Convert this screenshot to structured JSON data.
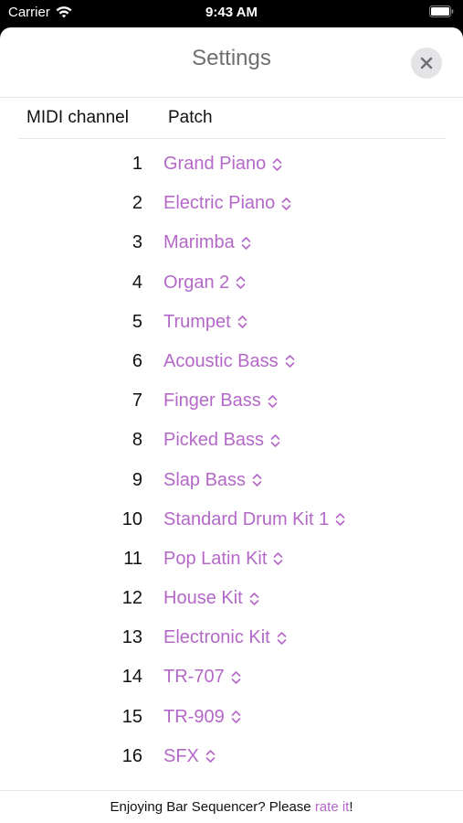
{
  "status_bar": {
    "carrier": "Carrier",
    "time": "9:43 AM"
  },
  "sheet": {
    "title": "Settings",
    "close_icon": "close-icon"
  },
  "table": {
    "headers": {
      "channel": "MIDI channel",
      "patch": "Patch"
    },
    "rows": [
      {
        "channel": "1",
        "patch": "Grand Piano"
      },
      {
        "channel": "2",
        "patch": "Electric Piano"
      },
      {
        "channel": "3",
        "patch": "Marimba"
      },
      {
        "channel": "4",
        "patch": "Organ 2"
      },
      {
        "channel": "5",
        "patch": "Trumpet"
      },
      {
        "channel": "6",
        "patch": "Acoustic Bass"
      },
      {
        "channel": "7",
        "patch": "Finger Bass"
      },
      {
        "channel": "8",
        "patch": "Picked Bass"
      },
      {
        "channel": "9",
        "patch": "Slap Bass"
      },
      {
        "channel": "10",
        "patch": "Standard Drum Kit 1"
      },
      {
        "channel": "11",
        "patch": "Pop Latin Kit"
      },
      {
        "channel": "12",
        "patch": "House Kit"
      },
      {
        "channel": "13",
        "patch": "Electronic Kit"
      },
      {
        "channel": "14",
        "patch": "TR-707"
      },
      {
        "channel": "15",
        "patch": "TR-909"
      },
      {
        "channel": "16",
        "patch": "SFX"
      }
    ]
  },
  "footer": {
    "prefix": "Enjoying Bar Sequencer? Please ",
    "link": "rate it",
    "suffix": "!"
  },
  "colors": {
    "accent": "#b468c7",
    "status_bar_bg": "#000000",
    "sheet_bg": "#ffffff"
  }
}
